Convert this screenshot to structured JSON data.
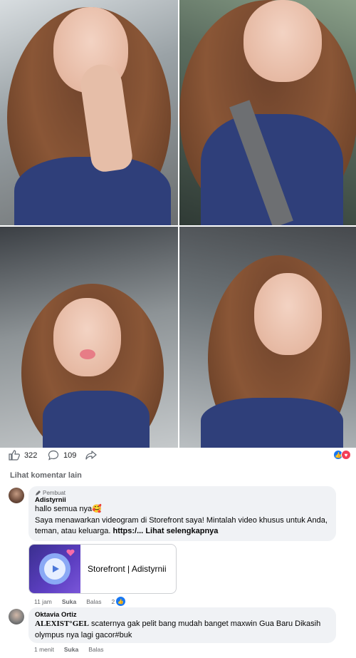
{
  "photos": [
    {
      "name": "photo-peace-sign"
    },
    {
      "name": "photo-seatbelt-smile"
    },
    {
      "name": "photo-tongue-out"
    },
    {
      "name": "photo-wink"
    }
  ],
  "actions": {
    "likes_count": "322",
    "comments_count": "109",
    "like_icon": "thumbs-up-icon",
    "comment_icon": "comment-icon",
    "share_icon": "share-icon",
    "reactions": [
      "like",
      "love"
    ],
    "like_color": "#1877f2",
    "love_color": "#f33e58"
  },
  "more_comments_label": "Lihat komentar lain",
  "comments": [
    {
      "author_badge": "Pembuat",
      "author": "Adistyrnii",
      "line1": "hallo semua nya🥰",
      "line2": "Saya menawarkan videogram di Storefront saya! Mintalah video khusus untuk Anda, teman, atau keluarga.",
      "link_prefix": "https:/...",
      "see_more": "Lihat selengkapnya",
      "card_title": "Storefront | Adistyrnii",
      "time": "11 jam",
      "like_label": "Suka",
      "reply_label": "Balas",
      "reaction_count": "2"
    },
    {
      "author": "Oktavia Ortiz",
      "bold_text": "ALEXIST°GEL",
      "text": "scaternya gak pelit bang mudah banget maxwin Gua Baru Dikasih olympus nya lagi gacor#buk",
      "time": "1 menit",
      "like_label": "Suka",
      "reply_label": "Balas"
    }
  ]
}
